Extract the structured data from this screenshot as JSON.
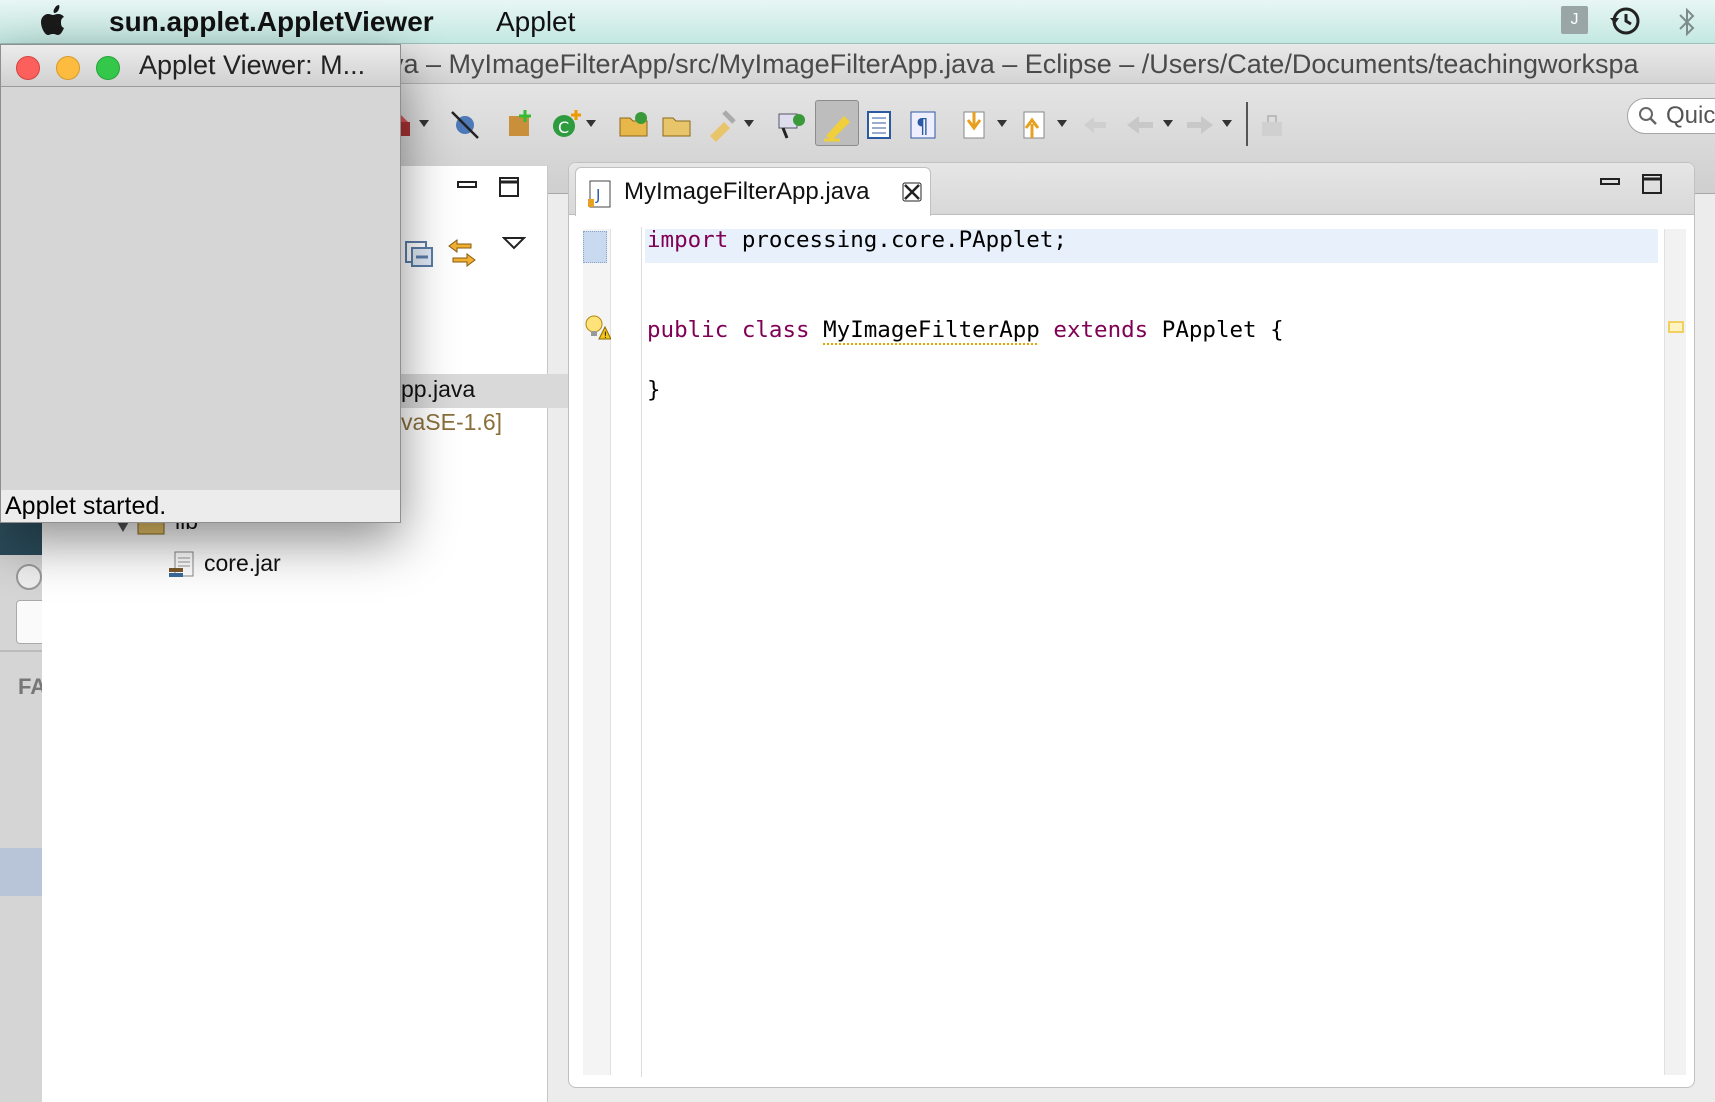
{
  "menubar": {
    "app_name": "sun.applet.AppletViewer",
    "menu_applet": "Applet",
    "extra_icon_letter": "J"
  },
  "eclipse": {
    "window_title": "va – MyImageFilterApp/src/MyImageFilterApp.java – Eclipse – /Users/Cate/Documents/teachingworkspa",
    "quick_access": "Quic"
  },
  "explorer": {
    "rows": [
      "pp.java",
      "vaSE-1.6]",
      "lib",
      "core.jar"
    ],
    "partial_label": "FA"
  },
  "editor": {
    "tab_label": "MyImageFilterApp.java",
    "lines": {
      "l1_kw": "import",
      "l1_rest": " processing.core.PApplet;",
      "l2_kw1": "public",
      "l2_kw2": "class",
      "l2_name": "MyImageFilterApp",
      "l2_kw3": "extends",
      "l2_rest": " PApplet {",
      "l3": "}"
    }
  },
  "applet_viewer": {
    "title": "Applet Viewer: M...",
    "status": "Applet started."
  },
  "colors": {
    "keyword": "#7f0055",
    "close_red": "#fc605c",
    "minimize_yellow": "#fdbc40",
    "zoom_green": "#34c84a"
  }
}
